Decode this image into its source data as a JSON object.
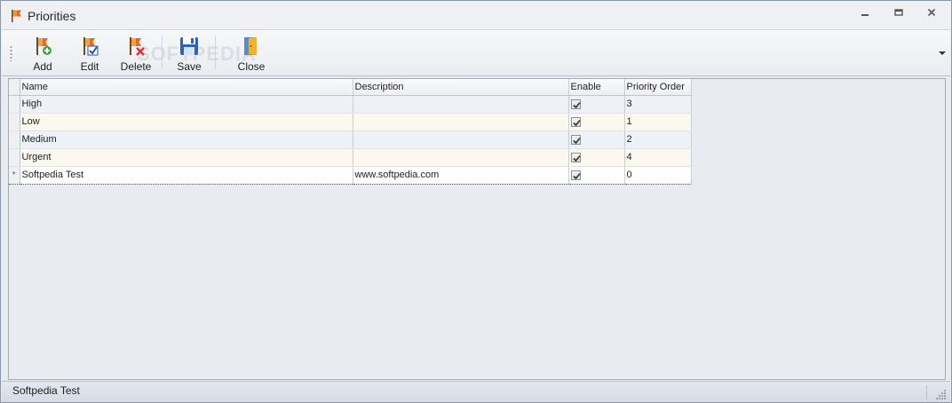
{
  "window": {
    "title": "Priorities",
    "icon": "orange-flag-icon",
    "controls": [
      "minimize-icon",
      "restore-icon",
      "close-icon"
    ]
  },
  "toolbar": {
    "buttons": [
      {
        "label": "Add",
        "icon": "flag-add-icon"
      },
      {
        "label": "Edit",
        "icon": "flag-edit-icon"
      },
      {
        "label": "Delete",
        "icon": "flag-delete-icon"
      },
      {
        "label": "Save",
        "icon": "floppy-disk-icon"
      },
      {
        "label": "Close",
        "icon": "door-exit-icon"
      }
    ],
    "watermark": "SOFTPEDIA"
  },
  "grid": {
    "columns": [
      "Name",
      "Description",
      "Enable",
      "Priority Order"
    ],
    "rows": [
      {
        "name": "High",
        "description": "",
        "enable": true,
        "order": "3"
      },
      {
        "name": "Low",
        "description": "",
        "enable": true,
        "order": "1"
      },
      {
        "name": "Medium",
        "description": "",
        "enable": true,
        "order": "2"
      },
      {
        "name": "Urgent",
        "description": "",
        "enable": true,
        "order": "4"
      },
      {
        "name": "Softpedia Test",
        "description": "www.softpedia.com",
        "enable": true,
        "order": "0",
        "indicator": "*"
      }
    ]
  },
  "statusbar": {
    "text": "Softpedia Test"
  },
  "colors": {
    "accent_orange": "#e8682a",
    "window_bg": "#e8ebf0",
    "row_odd": "#eef1f8",
    "row_even": "#fbf9ef"
  }
}
